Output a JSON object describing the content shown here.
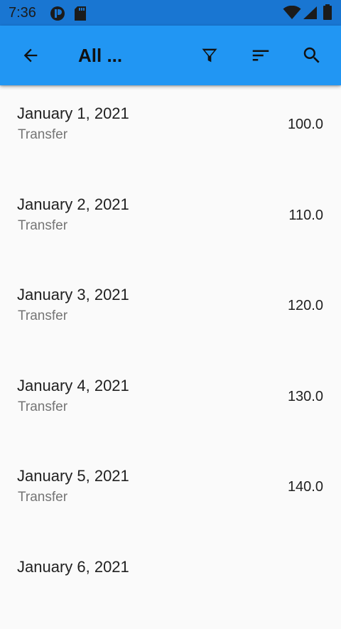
{
  "status_bar": {
    "time": "7:36",
    "icons": [
      "app-notification-icon",
      "sd-card-icon",
      "wifi-icon",
      "signal-icon",
      "battery-icon"
    ]
  },
  "app_bar": {
    "title": "All ...",
    "background": "#2196f3",
    "actions": [
      "back-arrow-icon",
      "filter-icon",
      "sort-icon",
      "search-icon"
    ]
  },
  "transactions": [
    {
      "date": "January 1, 2021",
      "type": "Transfer",
      "amount": "100.0"
    },
    {
      "date": "January 2, 2021",
      "type": "Transfer",
      "amount": "110.0"
    },
    {
      "date": "January 3, 2021",
      "type": "Transfer",
      "amount": "120.0"
    },
    {
      "date": "January 4, 2021",
      "type": "Transfer",
      "amount": "130.0"
    },
    {
      "date": "January 5, 2021",
      "type": "Transfer",
      "amount": "140.0"
    },
    {
      "date": "January 6, 2021",
      "type": "",
      "amount": ""
    }
  ]
}
